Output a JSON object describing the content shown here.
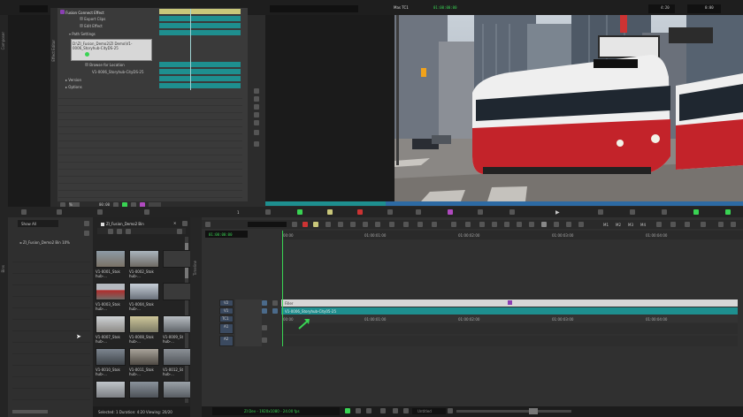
{
  "left_strip": {
    "label": "Composer"
  },
  "effect_editor": {
    "tab_label": "Effect Editor",
    "title": "Fusion Connect Effect",
    "items": [
      {
        "label": "Export Clips"
      },
      {
        "label": "Edit Effect"
      },
      {
        "label": "Path Settings"
      },
      {
        "label": "Browse for Location"
      },
      {
        "label": "V1-0006_Storyhub-CityDS-25"
      },
      {
        "label": "Version"
      },
      {
        "label": "Options"
      }
    ],
    "path_text": "D:\\ZI_Fusion_Demo2\\ZI Demo\\V1-0006_Storyhub-CityDS-25",
    "timecode": "00:00",
    "footer_left": "%",
    "footer_num": "1"
  },
  "viewer": {
    "source_label": "Mas TC1",
    "timecode_center": "01:00:00:00",
    "timecode_right": "4:20",
    "timecode_far": "0:00"
  },
  "bin": {
    "panel_title": "ZI_Fusion_Demo2 Bin",
    "dropdown": "Show All",
    "tree_item": "ZI_Fusion_Demo2 Bin  10%",
    "bin_tab": "Bins",
    "clips": [
      {
        "label": "V1-0001_Stok hub-..."
      },
      {
        "label": "V1-0002_Stok hub-..."
      },
      {
        "label": "V1-0003_Stok hub-..."
      },
      {
        "label": "V1-0004_Stok hub-..."
      },
      {
        "label": "V1-0005_Stok hub-..."
      },
      {
        "label": "V1-0006_Stok hub-..."
      },
      {
        "label": "V1-0007_Stok hub-..."
      },
      {
        "label": "V1-0008_Stok hub-..."
      },
      {
        "label": "V1-0009_St hub-..."
      },
      {
        "label": "V1-0010_Stok hub-..."
      },
      {
        "label": "V1-0011_Stok hub-..."
      },
      {
        "label": "V1-0012_St hub-..."
      },
      {
        "label": ""
      },
      {
        "label": ""
      },
      {
        "label": ""
      }
    ],
    "status": "Selected: 1  Duration: 4:20  Viewing: 20/20"
  },
  "timeline": {
    "side_label": "Timeline",
    "timecode": "01:00:00:00",
    "ruler": [
      "00:00",
      "01:00:01:00",
      "01:00:02:00",
      "01:00:03:00",
      "01:00:04:00"
    ],
    "ruler2": [
      "00:00",
      "01:00:01:00",
      "01:00:02:00",
      "01:00:03:00",
      "01:00:04:00"
    ],
    "tracks": [
      {
        "name": "V2",
        "clip": "Filler"
      },
      {
        "name": "V1",
        "clip": "V1-0006_Storyhub-City05-25"
      },
      {
        "name": "TC1",
        "clip": ""
      },
      {
        "name": "A1",
        "clip": ""
      },
      {
        "name": "A2",
        "clip": ""
      }
    ],
    "monitor_buttons": [
      "M1",
      "M2",
      "M3",
      "M4"
    ],
    "status": "ZI Dev - 1920x1080 - 24.00 fps",
    "zoom_label": "Untitled"
  },
  "colors": {
    "accent_green": "#39d353",
    "teal": "#1e8f8f",
    "highlight": "#c9c77a"
  }
}
